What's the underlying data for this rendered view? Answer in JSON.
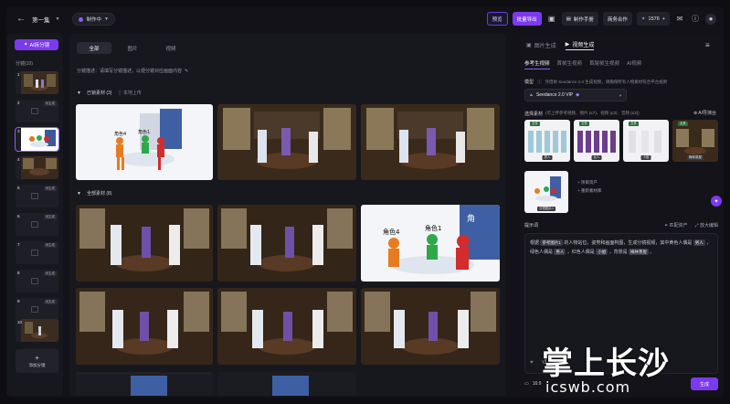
{
  "topbar": {
    "episode": "第一集",
    "status": "制作中",
    "preview_label": "预览",
    "batch_export_label": "批量导出",
    "manual_label": "制作手册",
    "business_label": "商务合作",
    "credits": "1576"
  },
  "sidebar": {
    "ai_split_label": "AI拆分镜",
    "shot_count_label": "分镜(10)",
    "shots": [
      {
        "num": "1",
        "tag": ""
      },
      {
        "num": "2",
        "tag": "未生成"
      },
      {
        "num": "3",
        "tag": ""
      },
      {
        "num": "4",
        "tag": ""
      },
      {
        "num": "5",
        "tag": "未生成"
      },
      {
        "num": "6",
        "tag": "未生成"
      },
      {
        "num": "7",
        "tag": "未生成"
      },
      {
        "num": "8",
        "tag": "未生成"
      },
      {
        "num": "9",
        "tag": "未生成"
      },
      {
        "num": "10",
        "tag": ""
      }
    ],
    "add_shot_label": "添加分镜"
  },
  "center": {
    "tabs": [
      "全部",
      "图片",
      "视频"
    ],
    "description": "分镜描述：请填写分镜描述，以便分镜对应画面内容",
    "section_locked": "已锁素材 (3)",
    "upload_label": "本地上传",
    "section_all": "全部素材 (8)",
    "role_labels": [
      "角色4",
      "角色1",
      "角色2",
      "角色3"
    ]
  },
  "right": {
    "tabs": [
      "图片生成",
      "视频生成"
    ],
    "subtabs": [
      "参考生视频",
      "首帧生视频",
      "首尾帧生视频",
      "AI视频"
    ],
    "model_label": "模型",
    "model_hint": "凭借依 Seedance 2.0 生成视频，请确保所有人物素材符合平台规则",
    "model_value": "Seedance 2.0 VIP",
    "materials_label": "选择素材",
    "materials_hint": "(可上传参考视频、图片 (≤7)、视频 (≤3)、音频 (≤3))",
    "import_label": "AI导演台",
    "materials": [
      {
        "tag": "文件",
        "name": "男人"
      },
      {
        "tag": "文件",
        "name": "女人"
      },
      {
        "tag": "文件",
        "name": "小姐"
      },
      {
        "tag": "文件",
        "name": "梅林茶屋"
      }
    ],
    "shot_card_name": "分镜图片1",
    "add_asset_1": "+ 项目资产",
    "add_asset_2": "+ 重新素材库",
    "prompt_label": "提示词",
    "prompt_match": "匹配资产",
    "prompt_expand": "放大编辑",
    "prompt_parts": [
      "根据",
      "的人物站位，姿势和画面构图，生成分镜视频，其中黄色人偶是",
      "，绿色人偶是",
      "，红色人偶是",
      "，背景是",
      "。"
    ],
    "prompt_chips": [
      "参考图片1",
      "男人",
      "男人",
      "小姐",
      "梅林茶屋"
    ],
    "ratio": "16:9",
    "generate_label": "生成"
  },
  "watermark": {
    "title": "掌上长沙",
    "sub": "icswb.com"
  }
}
